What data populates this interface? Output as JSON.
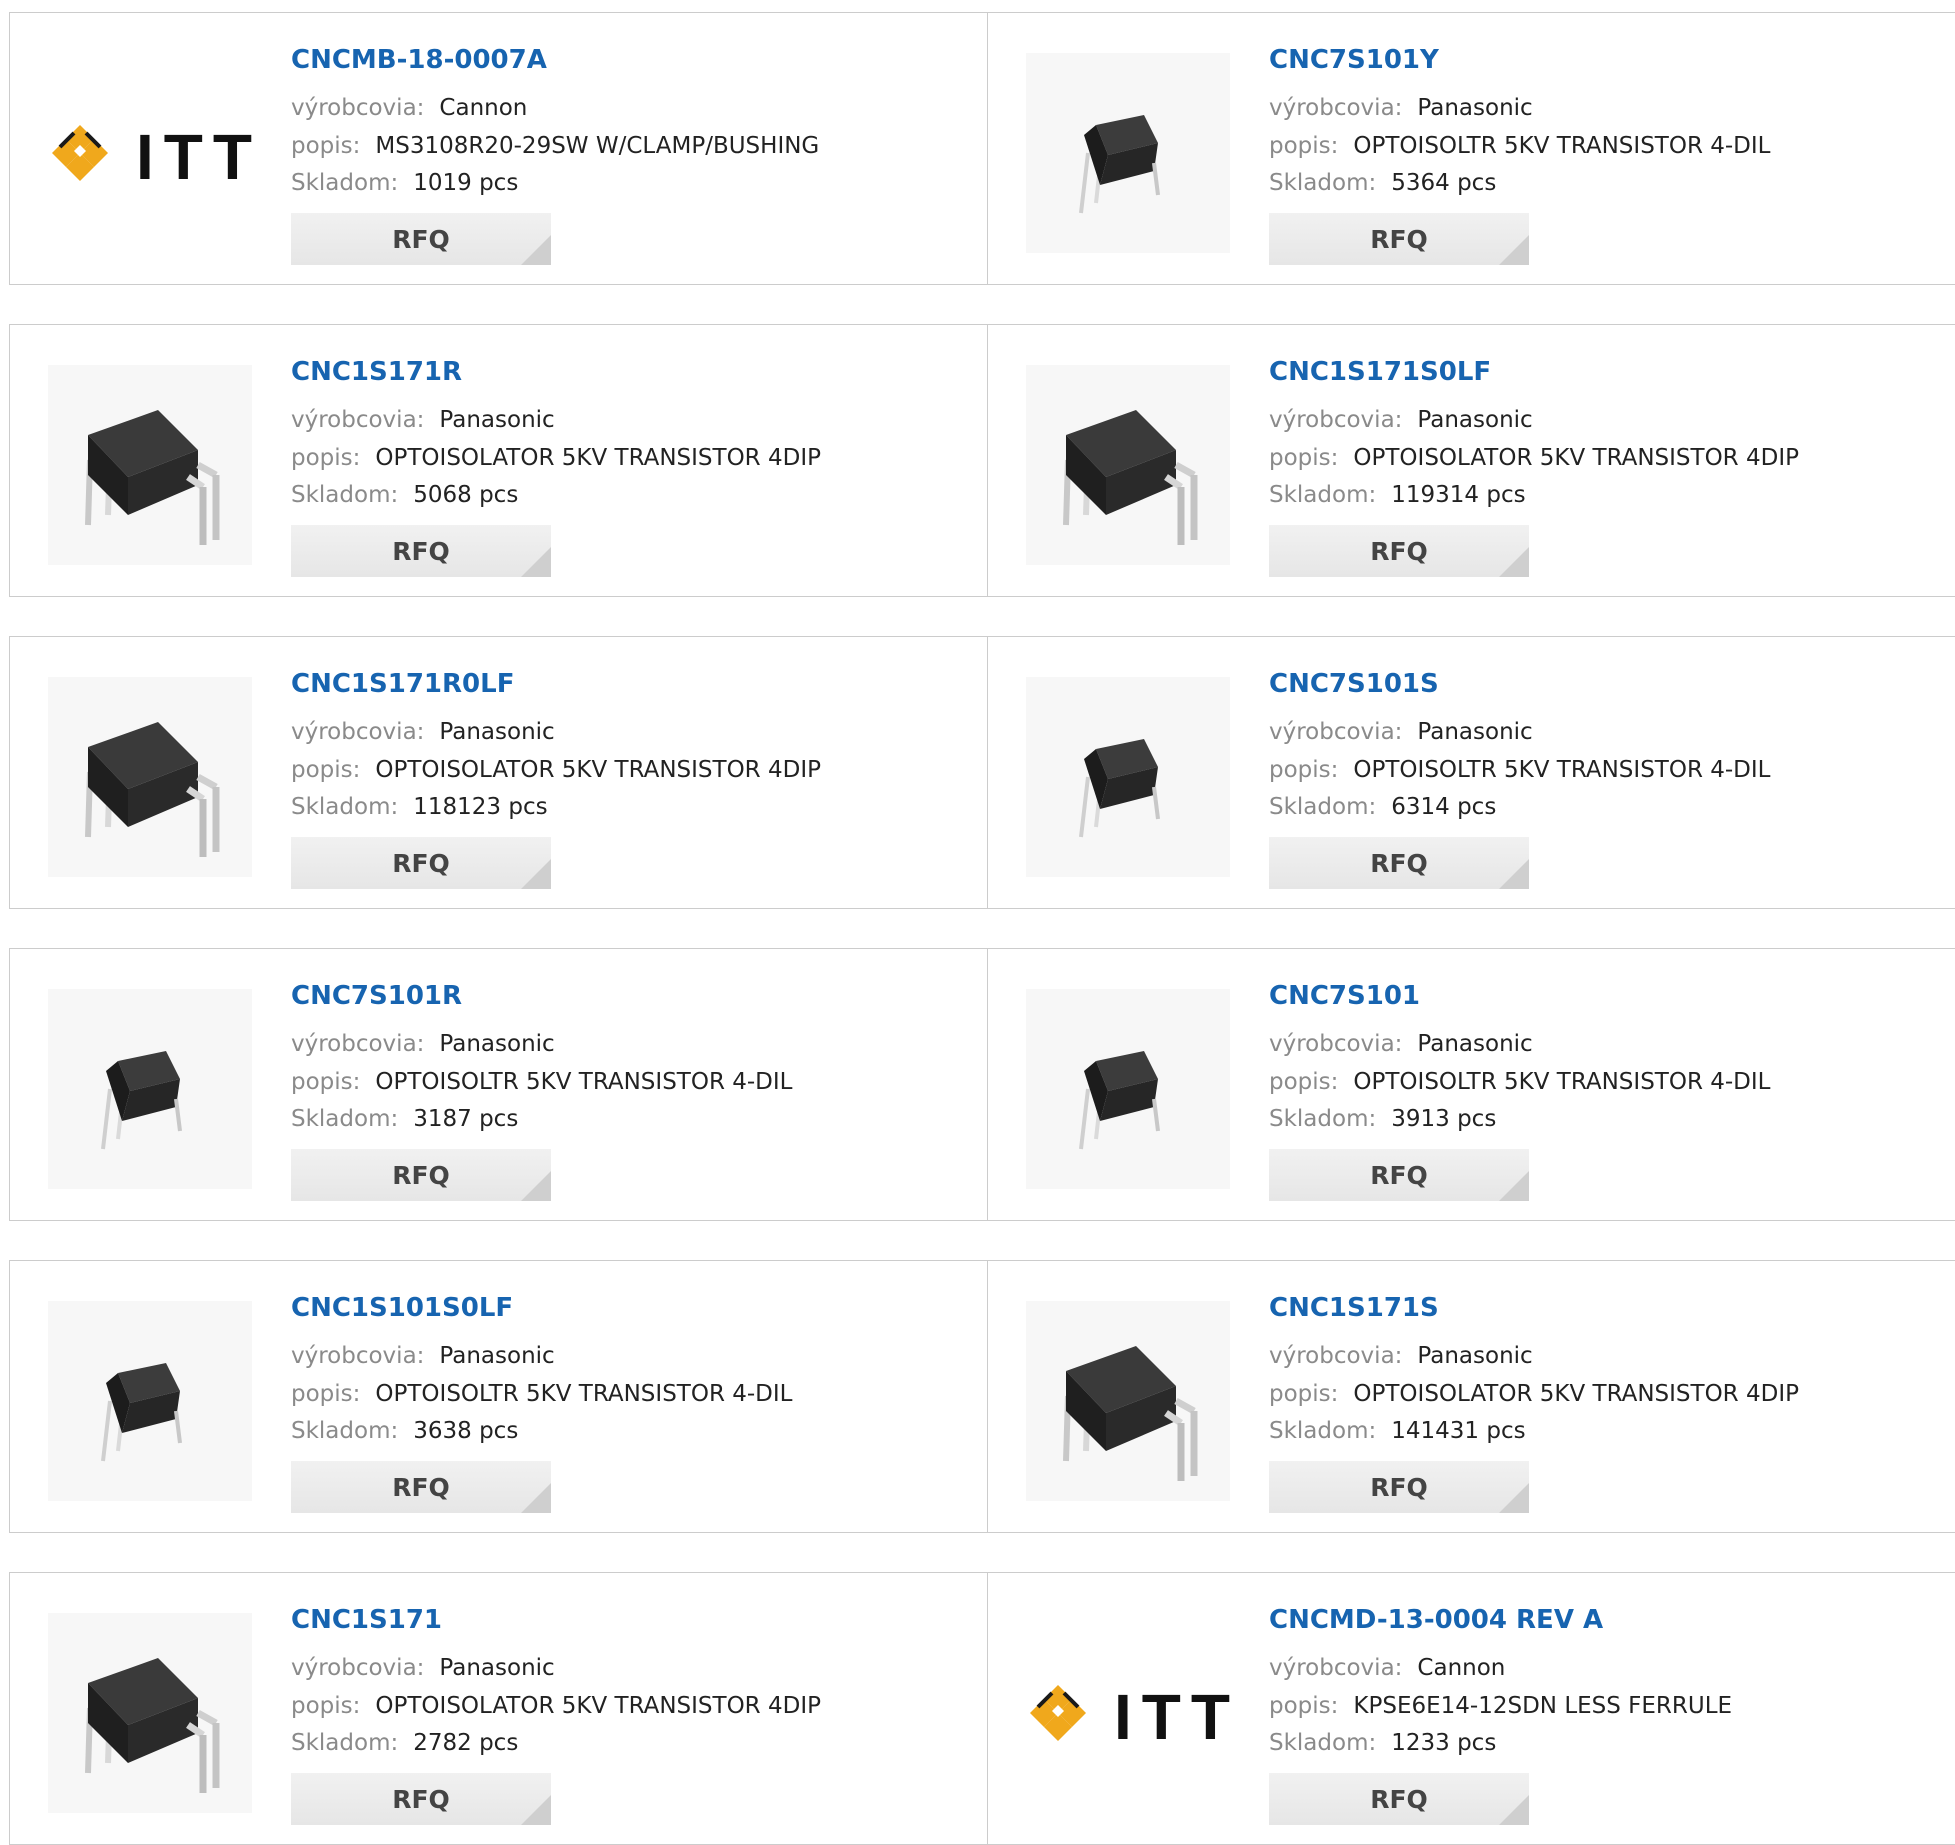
{
  "labels": {
    "manufacturer": "výrobcovia:",
    "description": "popis:",
    "stock": "Skladom:",
    "rfq": "RFQ"
  },
  "products": [
    {
      "part": "CNCMB-18-0007A",
      "manufacturer": "Cannon",
      "description": "MS3108R20-29SW W/CLAMP/BUSHING",
      "stock": "1019 pcs",
      "image": "itt-logo"
    },
    {
      "part": "CNC7S101Y",
      "manufacturer": "Panasonic",
      "description": "OPTOISOLTR 5KV TRANSISTOR 4-DIL",
      "stock": "5364 pcs",
      "image": "chip-small"
    },
    {
      "part": "CNC1S171R",
      "manufacturer": "Panasonic",
      "description": "OPTOISOLATOR 5KV TRANSISTOR 4DIP",
      "stock": "5068 pcs",
      "image": "chip-large"
    },
    {
      "part": "CNC1S171S0LF",
      "manufacturer": "Panasonic",
      "description": "OPTOISOLATOR 5KV TRANSISTOR 4DIP",
      "stock": "119314 pcs",
      "image": "chip-large"
    },
    {
      "part": "CNC1S171R0LF",
      "manufacturer": "Panasonic",
      "description": "OPTOISOLATOR 5KV TRANSISTOR 4DIP",
      "stock": "118123 pcs",
      "image": "chip-large"
    },
    {
      "part": "CNC7S101S",
      "manufacturer": "Panasonic",
      "description": "OPTOISOLTR 5KV TRANSISTOR 4-DIL",
      "stock": "6314 pcs",
      "image": "chip-small"
    },
    {
      "part": "CNC7S101R",
      "manufacturer": "Panasonic",
      "description": "OPTOISOLTR 5KV TRANSISTOR 4-DIL",
      "stock": "3187 pcs",
      "image": "chip-small"
    },
    {
      "part": "CNC7S101",
      "manufacturer": "Panasonic",
      "description": "OPTOISOLTR 5KV TRANSISTOR 4-DIL",
      "stock": "3913 pcs",
      "image": "chip-small"
    },
    {
      "part": "CNC1S101S0LF",
      "manufacturer": "Panasonic",
      "description": "OPTOISOLTR 5KV TRANSISTOR 4-DIL",
      "stock": "3638 pcs",
      "image": "chip-small"
    },
    {
      "part": "CNC1S171S",
      "manufacturer": "Panasonic",
      "description": "OPTOISOLATOR 5KV TRANSISTOR 4DIP",
      "stock": "141431 pcs",
      "image": "chip-large"
    },
    {
      "part": "CNC1S171",
      "manufacturer": "Panasonic",
      "description": "OPTOISOLATOR 5KV TRANSISTOR 4DIP",
      "stock": "2782 pcs",
      "image": "chip-large"
    },
    {
      "part": "CNCMD-13-0004 REV A",
      "manufacturer": "Cannon",
      "description": "KPSE6E14-12SDN LESS FERRULE",
      "stock": "1233 pcs",
      "image": "itt-logo"
    }
  ],
  "logo": {
    "text": "ITT",
    "diamond_color": "#f0a81c"
  }
}
